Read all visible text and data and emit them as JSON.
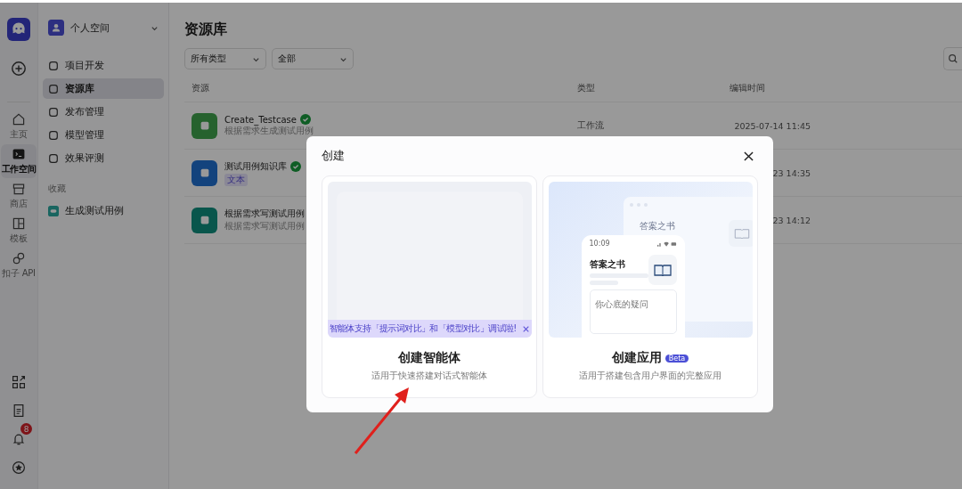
{
  "rail": {
    "items": [
      {
        "label": "主页",
        "selected": false
      },
      {
        "label": "工作空间",
        "selected": true
      },
      {
        "label": "商店",
        "selected": false
      },
      {
        "label": "模板",
        "selected": false
      },
      {
        "label": "扣子 API",
        "selected": false
      }
    ],
    "notification_badge": "8"
  },
  "sidebar": {
    "space": "个人空间",
    "items": [
      {
        "label": "项目开发",
        "selected": false
      },
      {
        "label": "资源库",
        "selected": true
      },
      {
        "label": "发布管理",
        "selected": false
      },
      {
        "label": "模型管理",
        "selected": false
      },
      {
        "label": "效果评测",
        "selected": false
      }
    ],
    "favorites_title": "收藏",
    "favorites": [
      {
        "label": "生成测试用例"
      }
    ]
  },
  "main": {
    "title": "资源库",
    "filters": [
      "所有类型",
      "全部"
    ],
    "table": {
      "columns": [
        "资源",
        "类型",
        "编辑时间"
      ],
      "rows": [
        {
          "name": "Create_Testcase",
          "verified": true,
          "subtitle": "根据需求生成测试用例",
          "color": "#26622e",
          "type": "工作流",
          "time": "2025-07-14 11:45"
        },
        {
          "name": "测试用例知识库",
          "verified": true,
          "tag": "文本",
          "color": "#13437d",
          "time": "23 14:35"
        },
        {
          "name": "根据需求写测试用例",
          "verified": false,
          "subtitle": "根据需求写测试用例",
          "color": "#09564c",
          "time": "23 14:12"
        }
      ]
    }
  },
  "modal": {
    "title": "创建",
    "cards": [
      {
        "kind": "agent",
        "title": "创建智能体",
        "desc": "适用于快速搭建对话式智能体",
        "banner": "智能体支持「提示词对比」和「模型对比」调试啦!"
      },
      {
        "kind": "app",
        "title": "创建应用",
        "badge": "Beta",
        "desc": "适用于搭建包含用户界面的完整应用",
        "mock": {
          "back_title": "答案之书",
          "time": "10:09",
          "front_title": "答案之书",
          "input_placeholder": "你心底的疑问"
        }
      }
    ]
  }
}
